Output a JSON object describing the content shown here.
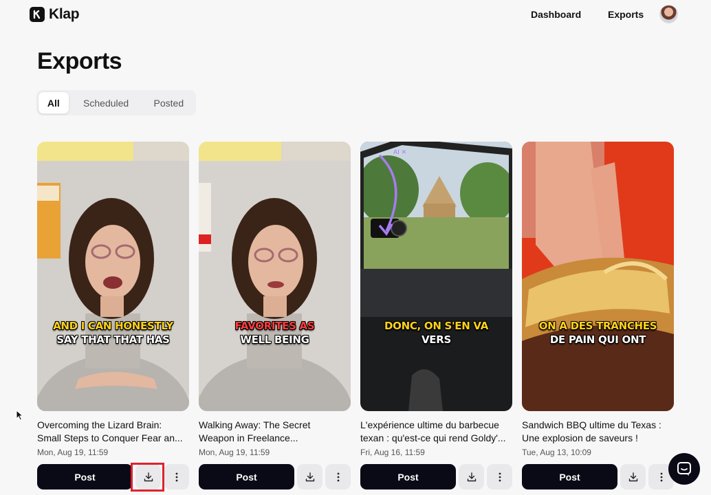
{
  "app": {
    "name": "Klap"
  },
  "nav": {
    "dashboard": "Dashboard",
    "exports": "Exports"
  },
  "page": {
    "title": "Exports"
  },
  "tabs": [
    {
      "label": "All",
      "active": true
    },
    {
      "label": "Scheduled",
      "active": false
    },
    {
      "label": "Posted",
      "active": false
    }
  ],
  "cards": [
    {
      "caption_line1": "AND I CAN HONESTLY",
      "caption_line2": "SAY THAT THAT HAS",
      "title_line1": "Overcoming the Lizard Brain:",
      "title_line2": "Small Steps to Conquer Fear an...",
      "date": "Mon, Aug 19, 11:59",
      "post_label": "Post"
    },
    {
      "caption_line1": "FAVORITES AS",
      "caption_line2": "WELL BEING",
      "title_line1": "Walking Away: The Secret",
      "title_line2": "Weapon in Freelance...",
      "date": "Mon, Aug 19, 11:59",
      "post_label": "Post"
    },
    {
      "caption_line1": "DONC, ON S'EN VA",
      "caption_line2": "VERS",
      "title_line1": "L'expérience ultime du barbecue",
      "title_line2": "texan : qu'est-ce qui rend Goldy'...",
      "date": "Fri, Aug 16, 11:59",
      "post_label": "Post"
    },
    {
      "caption_line1": "ON A DES TRANCHES",
      "caption_line2": "DE PAIN QUI ONT",
      "title_line1": "Sandwich BBQ ultime du Texas :",
      "title_line2": "Une explosion de saveurs !",
      "date": "Tue, Aug 13, 10:09",
      "post_label": "Post"
    }
  ],
  "icons": {
    "download": "download-icon",
    "more": "more-vertical-icon",
    "chat": "chat-icon"
  },
  "colors": {
    "primary": "#0a0a17",
    "background": "#f7f7f8",
    "highlight": "#e0222c"
  }
}
